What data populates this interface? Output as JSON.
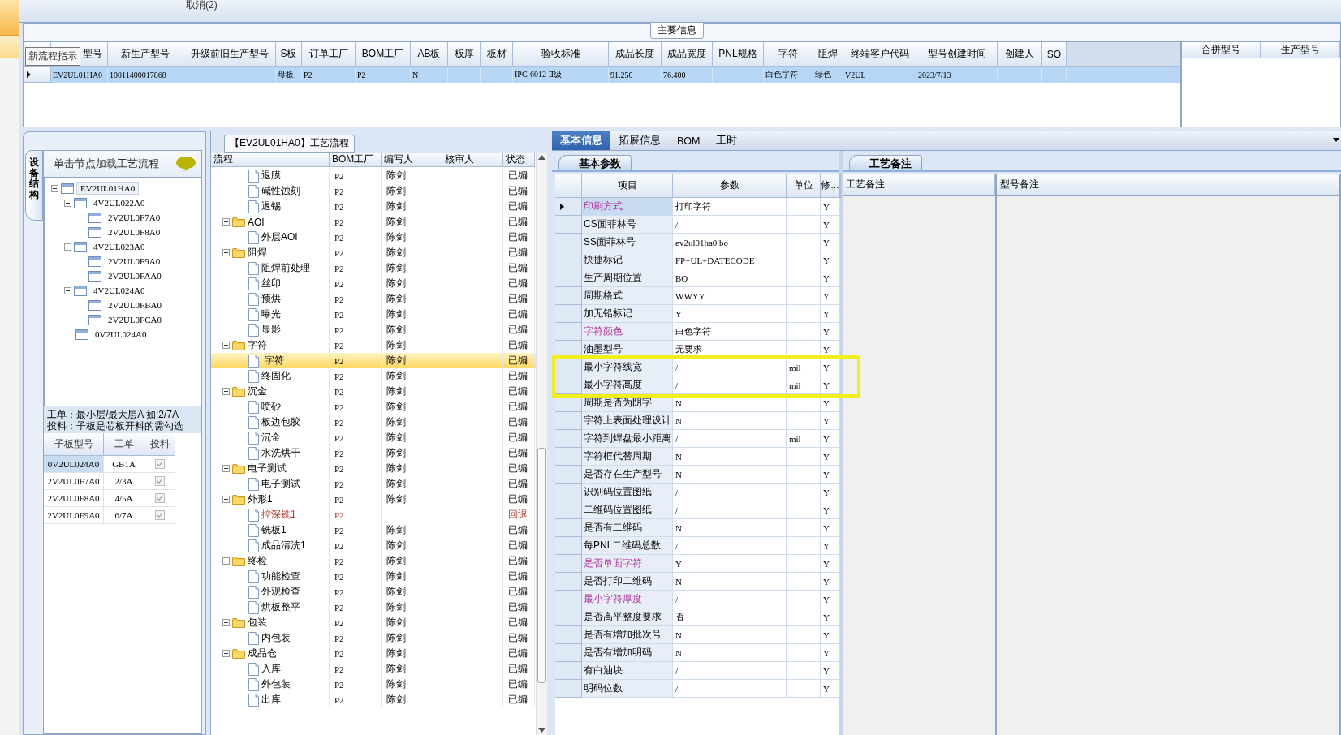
{
  "toolbar": {
    "label": "取消(2)"
  },
  "main_info": {
    "title": "主要信息",
    "tooltip": "新流程指示",
    "columns": [
      "型号",
      "新生产型号",
      "升级前旧生产型号",
      "S板",
      "订单工厂",
      "BOM工厂",
      "AB板",
      "板厚",
      "板材",
      "验收标准",
      "成品长度",
      "成品宽度",
      "PNL规格",
      "字符",
      "阻焊",
      "终端客户代码",
      "型号创建时间",
      "创建人",
      "SO"
    ],
    "rows": [
      {
        "selected": true,
        "cells": [
          "EV2UL01HA0",
          "10011400017868",
          null,
          "母板",
          "P2",
          "P2",
          "N",
          null,
          null,
          "IPC-6012 Ⅱ级",
          "91.250",
          "76.400",
          null,
          "白色字符",
          "绿色",
          "V2UL",
          "2023/7/13",
          null,
          null
        ]
      }
    ],
    "side_columns": [
      "合拼型号",
      "生产型号"
    ]
  },
  "structure": {
    "tab": "设备结构",
    "hint": "单击节点加载工艺流程",
    "tree": [
      {
        "label": "EV2UL01HA0",
        "expanded": true,
        "selected": true,
        "children": [
          {
            "label": "4V2UL022A0",
            "expanded": true,
            "selected": false,
            "children": [
              {
                "label": "2V2UL0F7A0",
                "selected": false
              },
              {
                "label": "2V2UL0F8A0",
                "selected": false
              }
            ]
          },
          {
            "label": "4V2UL023A0",
            "expanded": true,
            "selected": false,
            "children": [
              {
                "label": "2V2UL0F9A0",
                "selected": false
              },
              {
                "label": "2V2UL0FAA0",
                "selected": false
              }
            ]
          },
          {
            "label": "4V2UL024A0",
            "expanded": true,
            "selected": false,
            "children": [
              {
                "label": "2V2UL0FBA0",
                "selected": false
              },
              {
                "label": "2V2UL0FCA0",
                "selected": false
              }
            ]
          },
          {
            "label": "0V2UL024A0",
            "selected": false
          }
        ]
      }
    ],
    "note": [
      "工单：最小层/最大层A 如:2/7A",
      "投料：子板是芯板开料的需勾选"
    ],
    "grid": {
      "columns": [
        "子板型号",
        "工单",
        "投料"
      ],
      "rows": [
        {
          "cells": [
            "0V2UL024A0",
            "GB1A"
          ],
          "checked": true,
          "selected": true
        },
        {
          "cells": [
            "2V2UL0F7A0",
            "2/3A"
          ],
          "checked": true,
          "selected": false
        },
        {
          "cells": [
            "2V2UL0F8A0",
            "4/5A"
          ],
          "checked": true,
          "selected": false
        },
        {
          "cells": [
            "2V2UL0F9A0",
            "6/7A"
          ],
          "checked": true,
          "selected": false
        }
      ]
    }
  },
  "process": {
    "title": "【EV2UL01HA0】工艺流程",
    "columns": [
      "流程",
      "BOM工厂",
      "编写人",
      "核审人",
      "状态"
    ],
    "groups": [
      {
        "children": [
          {
            "label": "退膜",
            "bom": "P2",
            "writer": "陈剑",
            "status": "已编",
            "selected": false,
            "returned": false
          },
          {
            "label": "碱性蚀刻",
            "bom": "P2",
            "writer": "陈剑",
            "status": "已编",
            "selected": false,
            "returned": false
          },
          {
            "label": "退锡",
            "bom": "P2",
            "writer": "陈剑",
            "status": "已编",
            "selected": false,
            "returned": false
          }
        ]
      },
      {
        "label": "AOI",
        "bom": "P2",
        "writer": "陈剑",
        "status": "已编",
        "expanded": true,
        "selected": false,
        "children": [
          {
            "label": "外层AOI",
            "bom": "P2",
            "writer": "陈剑",
            "status": "已编",
            "selected": false,
            "returned": false
          }
        ]
      },
      {
        "label": "阻焊",
        "bom": "P2",
        "writer": "陈剑",
        "status": "已编",
        "expanded": true,
        "selected": false,
        "children": [
          {
            "label": "阻焊前处理",
            "bom": "P2",
            "writer": "陈剑",
            "status": "已编",
            "selected": false,
            "returned": false
          },
          {
            "label": "丝印",
            "bom": "P2",
            "writer": "陈剑",
            "status": "已编",
            "selected": false,
            "returned": false
          },
          {
            "label": "预烘",
            "bom": "P2",
            "writer": "陈剑",
            "status": "已编",
            "selected": false,
            "returned": false
          },
          {
            "label": "曝光",
            "bom": "P2",
            "writer": "陈剑",
            "status": "已编",
            "selected": false,
            "returned": false
          },
          {
            "label": "显影",
            "bom": "P2",
            "writer": "陈剑",
            "status": "已编",
            "selected": false,
            "returned": false
          }
        ]
      },
      {
        "label": "字符",
        "bom": "P2",
        "writer": "陈剑",
        "status": "已编",
        "expanded": true,
        "selected": false,
        "children": [
          {
            "label": "字符",
            "bom": "P2",
            "writer": "陈剑",
            "status": "已编",
            "selected": true,
            "returned": false
          },
          {
            "label": "终固化",
            "bom": "P2",
            "writer": "陈剑",
            "status": "已编",
            "selected": false,
            "returned": false
          }
        ]
      },
      {
        "label": "沉金",
        "bom": "P2",
        "writer": "陈剑",
        "status": "已编",
        "expanded": true,
        "selected": false,
        "children": [
          {
            "label": "喷砂",
            "bom": "P2",
            "writer": "陈剑",
            "status": "已编",
            "selected": false,
            "returned": false
          },
          {
            "label": "板边包胶",
            "bom": "P2",
            "writer": "陈剑",
            "status": "已编",
            "selected": false,
            "returned": false
          },
          {
            "label": "沉金",
            "bom": "P2",
            "writer": "陈剑",
            "status": "已编",
            "selected": false,
            "returned": false
          },
          {
            "label": "水洗烘干",
            "bom": "P2",
            "writer": "陈剑",
            "status": "已编",
            "selected": false,
            "returned": false
          }
        ]
      },
      {
        "label": "电子测试",
        "bom": "P2",
        "writer": "陈剑",
        "status": "已编",
        "expanded": true,
        "selected": false,
        "children": [
          {
            "label": "电子测试",
            "bom": "P2",
            "writer": "陈剑",
            "status": "已编",
            "selected": false,
            "returned": false
          }
        ]
      },
      {
        "label": "外形1",
        "bom": "P2",
        "writer": "陈剑",
        "status": "已编",
        "expanded": true,
        "selected": false,
        "children": [
          {
            "label": "控深铣1",
            "bom": "P2",
            "status": "回退",
            "selected": false,
            "returned": true
          },
          {
            "label": "铣板1",
            "bom": "P2",
            "writer": "陈剑",
            "status": "已编",
            "selected": false,
            "returned": false
          },
          {
            "label": "成品清洗1",
            "bom": "P2",
            "writer": "陈剑",
            "status": "已编",
            "selected": false,
            "returned": false
          }
        ]
      },
      {
        "label": "终检",
        "bom": "P2",
        "writer": "陈剑",
        "status": "已编",
        "expanded": true,
        "selected": false,
        "children": [
          {
            "label": "功能检查",
            "bom": "P2",
            "writer": "陈剑",
            "status": "已编",
            "selected": false,
            "returned": false
          },
          {
            "label": "外观检查",
            "bom": "P2",
            "writer": "陈剑",
            "status": "已编",
            "selected": false,
            "returned": false
          },
          {
            "label": "烘板整平",
            "bom": "P2",
            "writer": "陈剑",
            "status": "已编",
            "selected": false,
            "returned": false
          }
        ]
      },
      {
        "label": "包装",
        "bom": "P2",
        "writer": "陈剑",
        "status": "已编",
        "expanded": true,
        "selected": false,
        "children": [
          {
            "label": "内包装",
            "bom": "P2",
            "writer": "陈剑",
            "status": "已编",
            "selected": false,
            "returned": false
          }
        ]
      },
      {
        "label": "成品仓",
        "bom": "P2",
        "writer": "陈剑",
        "status": "已编",
        "expanded": true,
        "selected": false,
        "children": [
          {
            "label": "入库",
            "bom": "P2",
            "writer": "陈剑",
            "status": "已编",
            "selected": false,
            "returned": false
          },
          {
            "label": "外包装",
            "bom": "P2",
            "writer": "陈剑",
            "status": "已编",
            "selected": false,
            "returned": false
          },
          {
            "label": "出库",
            "bom": "P2",
            "writer": "陈剑",
            "status": "已编",
            "selected": false,
            "returned": false
          }
        ]
      }
    ]
  },
  "info": {
    "tabs": [
      {
        "label": "基本信息",
        "selected": true
      },
      {
        "label": "拓展信息",
        "selected": false
      },
      {
        "label": "BOM",
        "selected": false
      },
      {
        "label": "工时",
        "selected": false
      }
    ],
    "subtab": "基本参数",
    "columns": [
      "项目",
      "参数",
      "单位",
      "修..."
    ],
    "rows": [
      {
        "item": "印刷方式",
        "value": "打印字符",
        "flag": "Y",
        "emphasis": true,
        "selected": true,
        "boxed": false
      },
      {
        "item": "CS面菲林号",
        "value": "/",
        "flag": "Y",
        "emphasis": false,
        "selected": false,
        "boxed": false
      },
      {
        "item": "SS面菲林号",
        "value": "ev2ul01ha0.bo",
        "flag": "Y",
        "emphasis": false,
        "selected": false,
        "boxed": false
      },
      {
        "item": "快捷标记",
        "value": "FP+UL+DATECODE",
        "flag": "Y",
        "emphasis": false,
        "selected": false,
        "boxed": false
      },
      {
        "item": "生产周期位置",
        "value": "BO",
        "flag": "Y",
        "emphasis": false,
        "selected": false,
        "boxed": false
      },
      {
        "item": "周期格式",
        "value": "WWYY",
        "flag": "Y",
        "emphasis": false,
        "selected": false,
        "boxed": false
      },
      {
        "item": "加无铅标记",
        "value": "Y",
        "flag": "Y",
        "emphasis": false,
        "selected": false,
        "boxed": false
      },
      {
        "item": "字符颜色",
        "value": "白色字符",
        "flag": "Y",
        "emphasis": true,
        "selected": false,
        "boxed": false
      },
      {
        "item": "油墨型号",
        "value": "无要求",
        "flag": "Y",
        "emphasis": false,
        "selected": false,
        "boxed": false
      },
      {
        "item": "最小字符线宽",
        "value": "/",
        "unit": "mil",
        "flag": "Y",
        "emphasis": false,
        "selected": false,
        "boxed": true
      },
      {
        "item": "最小字符高度",
        "value": "/",
        "unit": "mil",
        "flag": "Y",
        "emphasis": false,
        "selected": false,
        "boxed": true
      },
      {
        "item": "周期是否为阴字",
        "value": "N",
        "flag": "Y",
        "emphasis": false,
        "selected": false,
        "boxed": false
      },
      {
        "item": "字符上表面处理设计",
        "value": "N",
        "flag": "Y",
        "emphasis": false,
        "selected": false,
        "boxed": false
      },
      {
        "item": "字符到焊盘最小距离",
        "value": "/",
        "unit": "mil",
        "flag": "Y",
        "emphasis": false,
        "selected": false,
        "boxed": false
      },
      {
        "item": "字符框代替周期",
        "value": "N",
        "flag": "Y",
        "emphasis": false,
        "selected": false,
        "boxed": false
      },
      {
        "item": "是否存在生产型号",
        "value": "N",
        "flag": "Y",
        "emphasis": false,
        "selected": false,
        "boxed": false
      },
      {
        "item": "识别码位置图纸",
        "value": "/",
        "flag": "Y",
        "emphasis": false,
        "selected": false,
        "boxed": false
      },
      {
        "item": "二维码位置图纸",
        "value": "/",
        "flag": "Y",
        "emphasis": false,
        "selected": false,
        "boxed": false
      },
      {
        "item": "是否有二维码",
        "value": "N",
        "flag": "Y",
        "emphasis": false,
        "selected": false,
        "boxed": false
      },
      {
        "item": "每PNL二维码总数",
        "value": "/",
        "flag": "Y",
        "emphasis": false,
        "selected": false,
        "boxed": false
      },
      {
        "item": "是否单面字符",
        "value": "Y",
        "flag": "Y",
        "emphasis": true,
        "selected": false,
        "boxed": false
      },
      {
        "item": "是否打印二维码",
        "value": "N",
        "flag": "Y",
        "emphasis": false,
        "selected": false,
        "boxed": false
      },
      {
        "item": "最小字符厚度",
        "value": "/",
        "flag": "Y",
        "emphasis": true,
        "selected": false,
        "boxed": false
      },
      {
        "item": "是否高平整度要求",
        "value": "否",
        "flag": "Y",
        "emphasis": false,
        "selected": false,
        "boxed": false
      },
      {
        "item": "是否有增加批次号",
        "value": "N",
        "flag": "Y",
        "emphasis": false,
        "selected": false,
        "boxed": false
      },
      {
        "item": "是否有增加明码",
        "value": "N",
        "flag": "Y",
        "emphasis": false,
        "selected": false,
        "boxed": false
      },
      {
        "item": "有白油块",
        "value": "/",
        "flag": "Y",
        "emphasis": false,
        "selected": false,
        "boxed": false
      },
      {
        "item": "明码位数",
        "value": "/",
        "flag": "Y",
        "emphasis": false,
        "selected": false,
        "boxed": false
      }
    ]
  },
  "remarks": {
    "tab": "工艺备注",
    "columns": [
      "工艺备注",
      "型号备注"
    ]
  }
}
